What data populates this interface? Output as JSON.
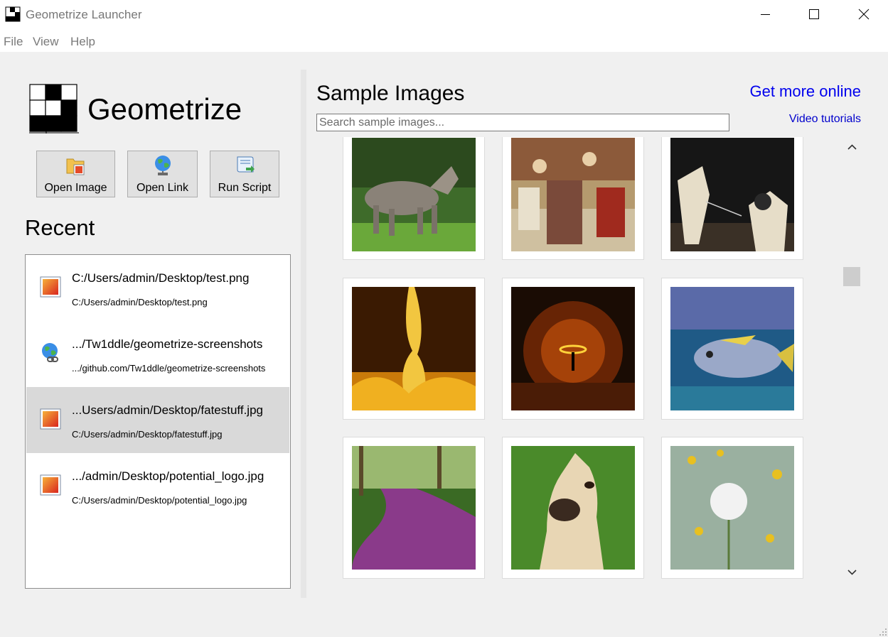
{
  "window": {
    "title": "Geometrize Launcher"
  },
  "menu": [
    "File",
    "View",
    "Help"
  ],
  "brand": {
    "name": "Geometrize"
  },
  "toolbar": {
    "open_image": "Open Image",
    "open_link": "Open Link",
    "run_script": "Run Script"
  },
  "recent": {
    "title": "Recent",
    "items": [
      {
        "title": "C:/Users/admin/Desktop/test.png",
        "subtitle": "C:/Users/admin/Desktop/test.png",
        "icon": "image-file-icon",
        "selected": false
      },
      {
        "title": ".../Tw1ddle/geometrize-screenshots",
        "subtitle": ".../github.com/Tw1ddle/geometrize-screenshots",
        "icon": "web-link-icon",
        "selected": false
      },
      {
        "title": "...Users/admin/Desktop/fatestuff.jpg",
        "subtitle": "C:/Users/admin/Desktop/fatestuff.jpg",
        "icon": "image-file-icon",
        "selected": true
      },
      {
        "title": ".../admin/Desktop/potential_logo.jpg",
        "subtitle": "C:/Users/admin/Desktop/potential_logo.jpg",
        "icon": "image-file-icon",
        "selected": false
      }
    ]
  },
  "samples": {
    "title": "Sample Images",
    "search_placeholder": "Search sample images...",
    "get_more": "Get more online",
    "video_tutorials": "Video tutorials",
    "images": [
      "wolf",
      "medieval-painting",
      "fencing",
      "fire",
      "steel-wool",
      "fish",
      "flower-path",
      "foal",
      "dandelion"
    ]
  },
  "colors": {
    "link": "#0000ee",
    "selection": "#d9d9d9",
    "background": "#f0f0f0"
  }
}
